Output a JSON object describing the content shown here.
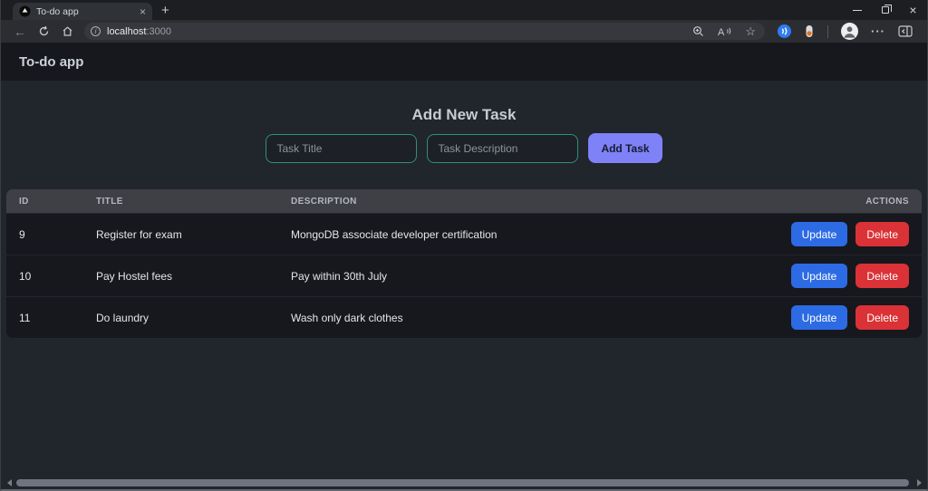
{
  "browser": {
    "tab": {
      "title": "To-do app",
      "close_glyph": "×"
    },
    "new_tab_glyph": "+",
    "window_controls": {
      "close_glyph": "×"
    },
    "toolbar": {
      "back_glyph": "←",
      "info_glyph": "i",
      "url_host": "localhost",
      "url_port": ":3000",
      "star_glyph": "☆",
      "more_glyph": "···"
    }
  },
  "app": {
    "header_title": "To-do app",
    "form": {
      "heading": "Add New Task",
      "title_placeholder": "Task Title",
      "description_placeholder": "Task Description",
      "submit_label": "Add Task"
    },
    "table": {
      "columns": [
        "ID",
        "TITLE",
        "DESCRIPTION",
        "ACTIONS"
      ],
      "rows": [
        {
          "id": "9",
          "title": "Register for exam",
          "description": "MongoDB associate developer certification"
        },
        {
          "id": "10",
          "title": "Pay Hostel fees",
          "description": "Pay within 30th July"
        },
        {
          "id": "11",
          "title": "Do laundry",
          "description": "Wash only dark clothes"
        }
      ],
      "actions": {
        "update_label": "Update",
        "delete_label": "Delete"
      }
    },
    "colors": {
      "accent_button": "#7e82f6",
      "input_border": "#2f8f7c",
      "update_button": "#2d6be4",
      "delete_button": "#da3236",
      "page_background": "#21252c",
      "table_header_background": "#3e4046",
      "app_header_background": "#16181d"
    }
  }
}
